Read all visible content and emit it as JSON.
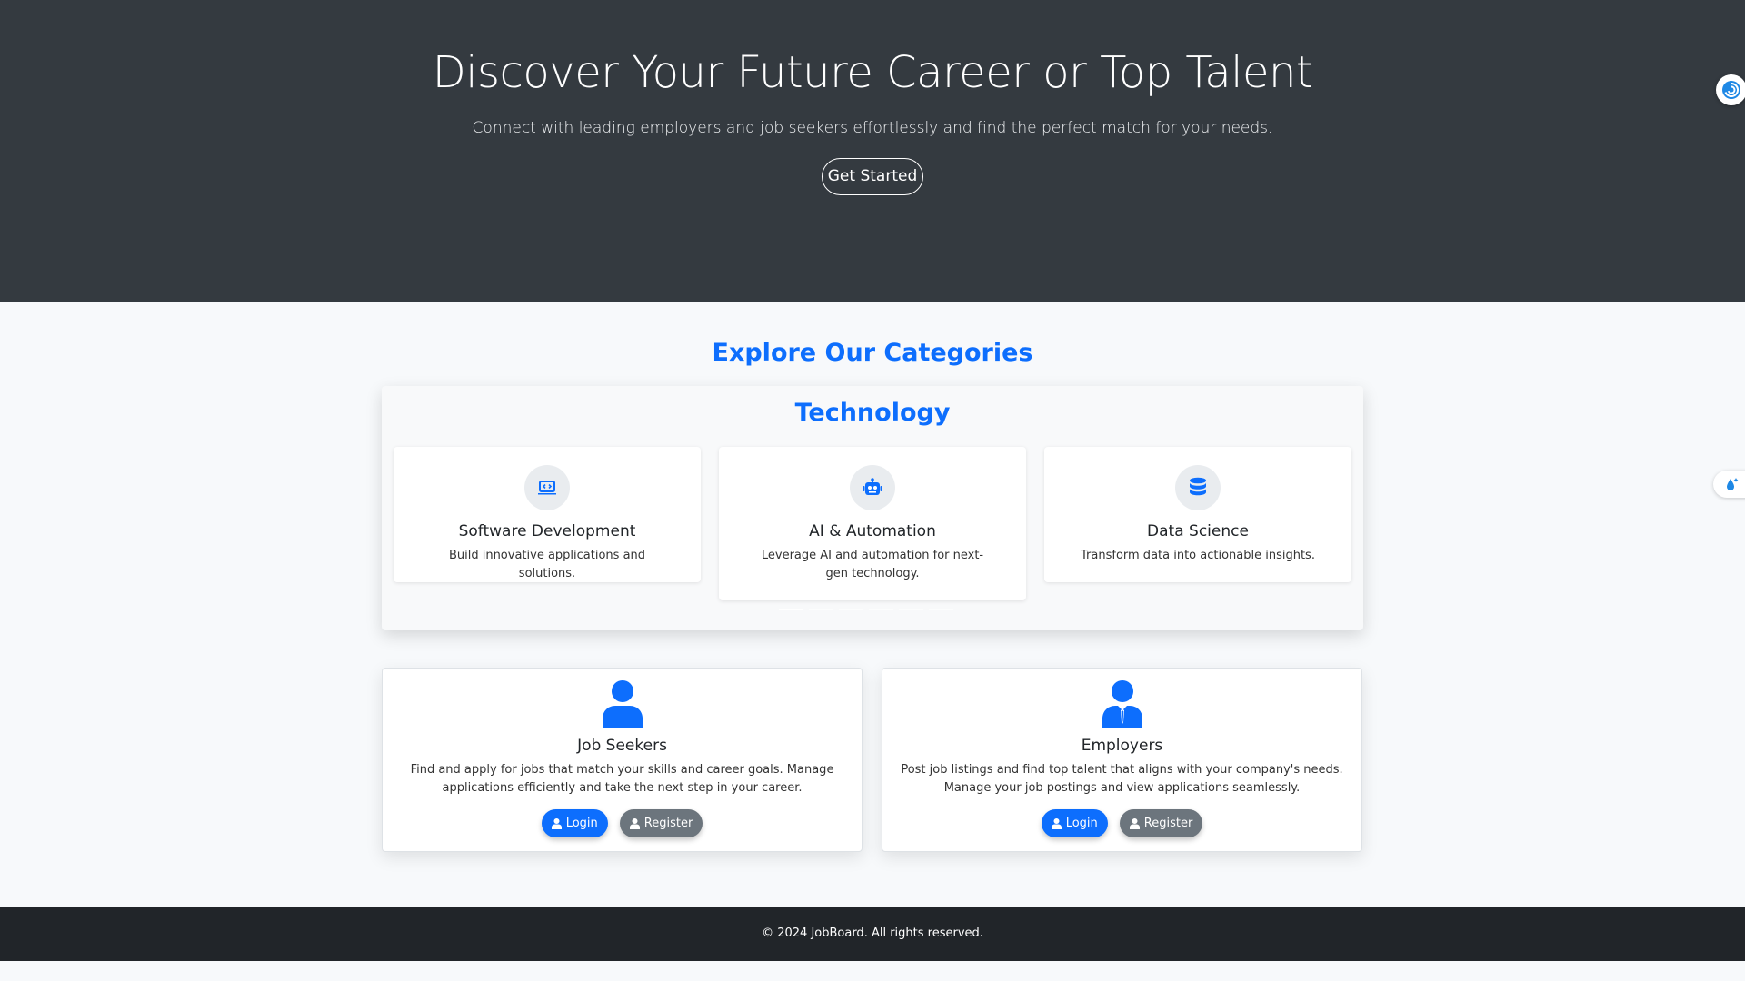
{
  "hero": {
    "title": "Discover Your Future Career or Top Talent",
    "subtitle": "Connect with leading employers and job seekers effortlessly and find the perfect match for your needs.",
    "cta_label": "Get Started"
  },
  "categories": {
    "section_title": "Explore Our Categories",
    "group_title": "Technology",
    "items": [
      {
        "icon": "laptop-code-icon",
        "name": "Software Development",
        "description": "Build innovative applications and solutions."
      },
      {
        "icon": "robot-icon",
        "name": "AI & Automation",
        "description": "Leverage AI and automation for next-gen technology."
      },
      {
        "icon": "database-icon",
        "name": "Data Science",
        "description": "Transform data into actionable insights."
      }
    ]
  },
  "audiences": [
    {
      "icon": "user-icon",
      "title": "Job Seekers",
      "description": "Find and apply for jobs that match your skills and career goals. Manage applications efficiently and take the next step in your career.",
      "login_label": "Login",
      "register_label": "Register"
    },
    {
      "icon": "user-tie-icon",
      "title": "Employers",
      "description": "Post job listings and find top talent that aligns with your company's needs. Manage your job postings and view applications seamlessly.",
      "login_label": "Login",
      "register_label": "Register"
    }
  ],
  "footer": {
    "text": "© 2024 JobBoard. All rights reserved."
  },
  "colors": {
    "hero_bg": "#343a40",
    "accent": "#0d6efd",
    "secondary": "#6c757d",
    "footer_bg": "#212529"
  }
}
